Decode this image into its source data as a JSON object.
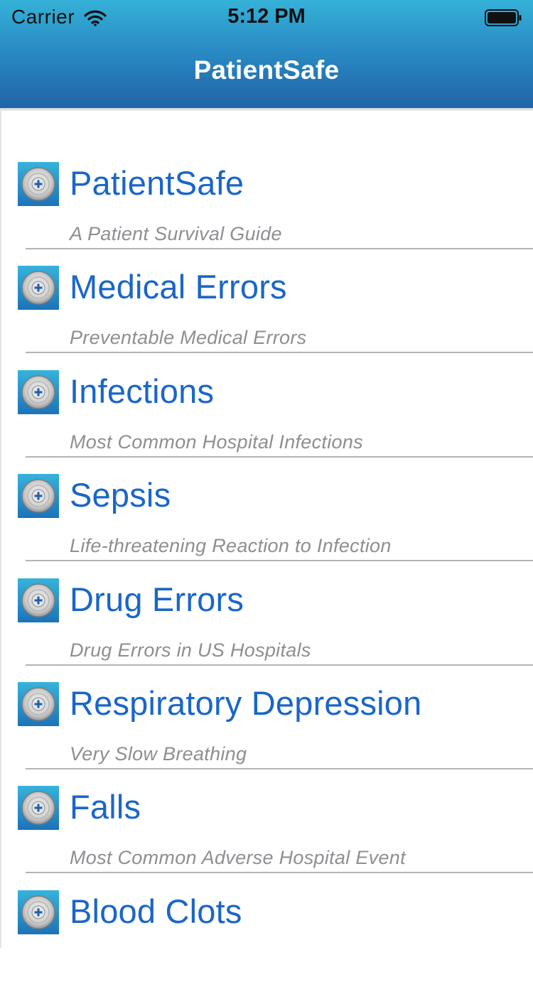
{
  "status_bar": {
    "carrier": "Carrier",
    "time": "5:12 PM",
    "wifi_icon": "wifi-icon",
    "battery_icon": "battery-icon"
  },
  "nav": {
    "title": "PatientSafe"
  },
  "colors": {
    "header_top": "#35b2d8",
    "header_bottom": "#1f63a8",
    "title_blue": "#1a66c9",
    "subtitle_gray": "#8e8e93"
  },
  "items": [
    {
      "title": "PatientSafe",
      "subtitle": "A Patient Survival Guide",
      "icon": "app-logo-icon"
    },
    {
      "title": "Medical Errors",
      "subtitle": "Preventable Medical Errors",
      "icon": "app-logo-icon"
    },
    {
      "title": "Infections",
      "subtitle": "Most Common Hospital Infections",
      "icon": "app-logo-icon"
    },
    {
      "title": "Sepsis",
      "subtitle": "Life-threatening Reaction to Infection",
      "icon": "app-logo-icon"
    },
    {
      "title": "Drug Errors",
      "subtitle": "Drug Errors in US Hospitals",
      "icon": "app-logo-icon"
    },
    {
      "title": "Respiratory Depression",
      "subtitle": "Very Slow Breathing",
      "icon": "app-logo-icon"
    },
    {
      "title": "Falls",
      "subtitle": "Most Common Adverse Hospital Event",
      "icon": "app-logo-icon"
    },
    {
      "title": "Blood Clots",
      "subtitle": "",
      "icon": "app-logo-icon"
    }
  ]
}
